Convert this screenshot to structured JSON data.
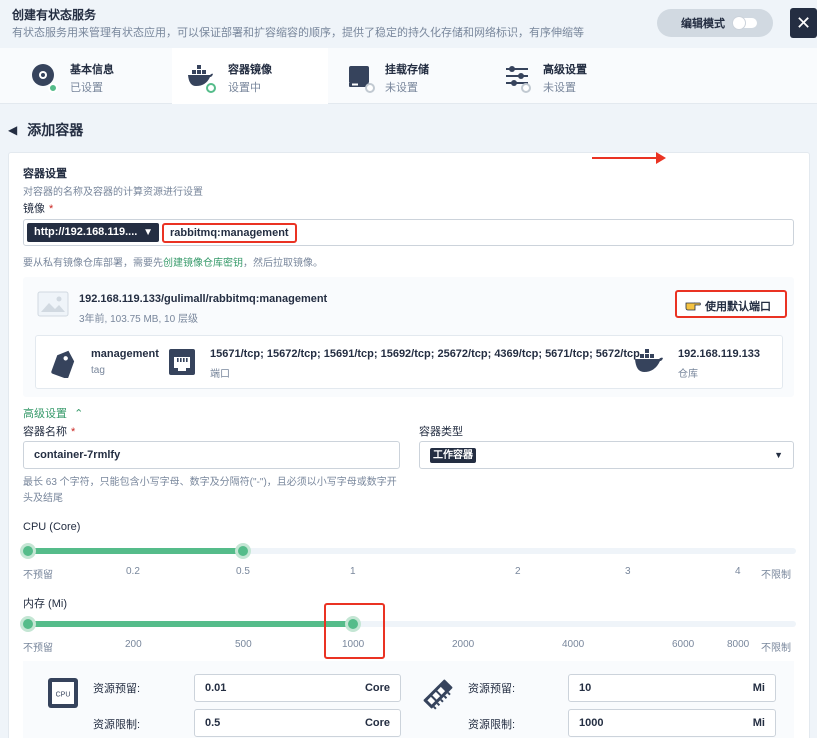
{
  "header": {
    "title": "创建有状态服务",
    "subtitle": "有状态服务用来管理有状态应用，可以保证部署和扩容缩容的顺序，提供了稳定的持久化存储和网络标识，有序伸缩等",
    "edit_mode_label": "编辑模式",
    "close_symbol": "✕"
  },
  "steps": [
    {
      "name": "基本信息",
      "state": "已设置",
      "icon": "disc-icon"
    },
    {
      "name": "容器镜像",
      "state": "设置中",
      "icon": "docker-icon"
    },
    {
      "name": "挂载存储",
      "state": "未设置",
      "icon": "storage-icon"
    },
    {
      "name": "高级设置",
      "state": "未设置",
      "icon": "sliders-icon"
    }
  ],
  "page": {
    "back_arrow": "◀",
    "title": "添加容器"
  },
  "container_settings": {
    "title": "容器设置",
    "desc": "对容器的名称及容器的计算资源进行设置",
    "image_label": "镜像",
    "required_mark": "*",
    "registry_value": "http://192.168.119....",
    "image_value": "rabbitmq:management",
    "hint_prefix": "要从私有镜像仓库部署，需要先",
    "hint_link": "创建镜像仓库密钥",
    "hint_suffix": "，然后拉取镜像。"
  },
  "image_result": {
    "full_name": "192.168.119.133/gulimall/rabbitmq:management",
    "meta": "3年前, 103.75 MB, 10 层级",
    "use_default_ports_label": "使用默认端口",
    "tag_value": "management",
    "tag_label": "tag",
    "ports_value": "15671/tcp; 15672/tcp; 15691/tcp; 15692/tcp; 25672/tcp; 4369/tcp; 5671/tcp; 5672/tcp",
    "ports_label": "端口",
    "repo_value": "192.168.119.133",
    "repo_label": "仓库"
  },
  "advanced": {
    "toggle_label": "高级设置",
    "name_label": "容器名称",
    "name_value": "container-7rmlfy",
    "name_hint": "最长 63 个字符，只能包含小写字母、数字及分隔符(\"-\")，且必须以小写字母或数字开头及结尾",
    "type_label": "容器类型",
    "type_value": "工作容器"
  },
  "cpu": {
    "label": "CPU (Core)",
    "ticks": [
      "不预留",
      "0.2",
      "0.5",
      "1",
      "2",
      "3",
      "4",
      "不限制"
    ],
    "reserve": 0.01,
    "limit": 0.5
  },
  "memory": {
    "label": "内存 (Mi)",
    "ticks": [
      "不预留",
      "200",
      "500",
      "1000",
      "2000",
      "4000",
      "6000",
      "8000",
      "不限制"
    ],
    "reserve": 10,
    "limit": 1000
  },
  "resources": {
    "cpu_reserve_label": "资源预留:",
    "cpu_reserve_value": "0.01",
    "cpu_reserve_unit": "Core",
    "cpu_limit_label": "资源限制:",
    "cpu_limit_value": "0.5",
    "cpu_limit_unit": "Core",
    "cpu_chip_text": "CPU",
    "mem_reserve_label": "资源预留:",
    "mem_reserve_value": "10",
    "mem_reserve_unit": "Mi",
    "mem_limit_label": "资源限制:",
    "mem_limit_value": "1000",
    "mem_limit_unit": "Mi"
  },
  "colors": {
    "accent": "#55bc8a",
    "dark": "#242e42",
    "highlight": "#ea3323"
  }
}
